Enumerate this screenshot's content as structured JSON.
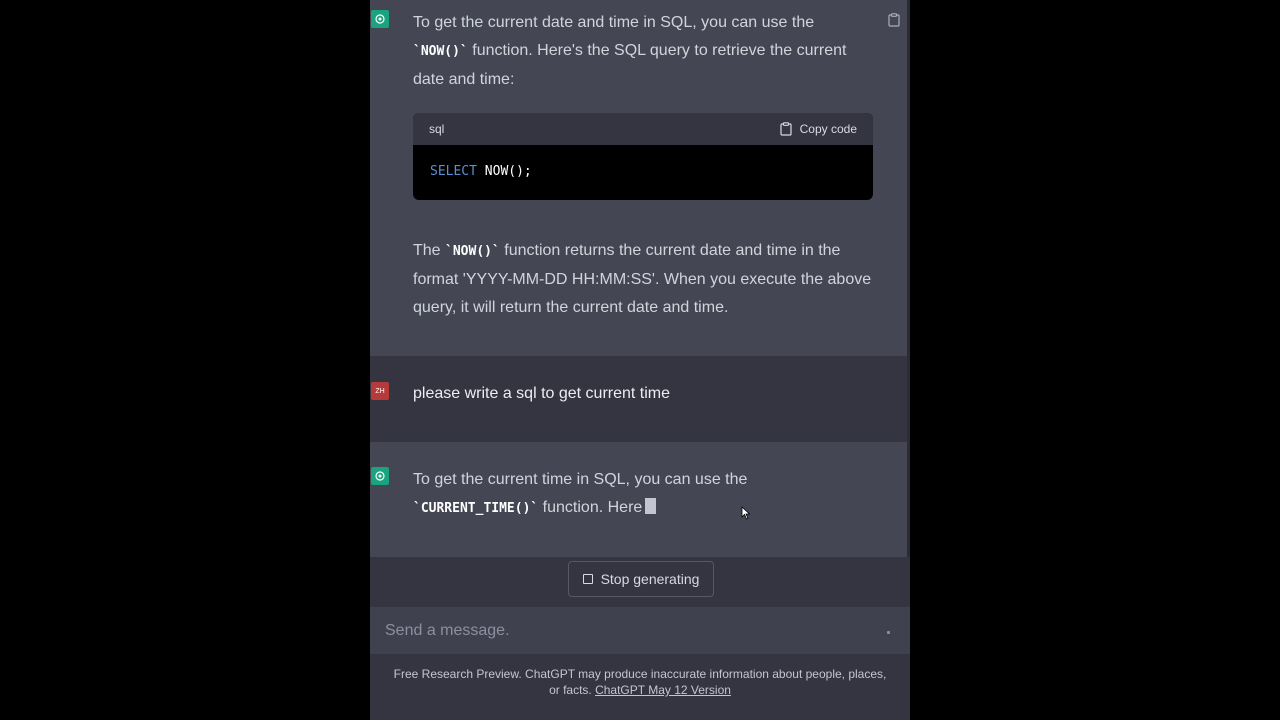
{
  "messages": {
    "ai1": {
      "intro_pre": "To get the current date and time in SQL, you can use the ",
      "intro_code": "`NOW()`",
      "intro_post": " function. Here's the SQL query to retrieve the current date and time:",
      "code_lang": "sql",
      "copy_label": "Copy code",
      "code_keyword": "SELECT",
      "code_rest": " NOW();",
      "outro_pre": "The ",
      "outro_code": "`NOW()`",
      "outro_post": " function returns the current date and time in the format 'YYYY-MM-DD HH:MM:SS'. When you execute the above query, it will return the current date and time."
    },
    "user": {
      "initials": "ZH",
      "text": "please write a sql to get current time"
    },
    "ai2": {
      "pre": "To get the current time in SQL, you can use the ",
      "code": "`CURRENT_TIME()`",
      "post": " function. Here"
    }
  },
  "controls": {
    "stop_label": "Stop generating",
    "input_placeholder": "Send a message."
  },
  "footer": {
    "text": "Free Research Preview. ChatGPT may produce inaccurate information about people, places, or facts. ",
    "link": "ChatGPT May 12 Version"
  },
  "colors": {
    "assistant_avatar": "#19a37f",
    "user_avatar": "#b73a3a",
    "keyword": "#5b8fd1"
  }
}
